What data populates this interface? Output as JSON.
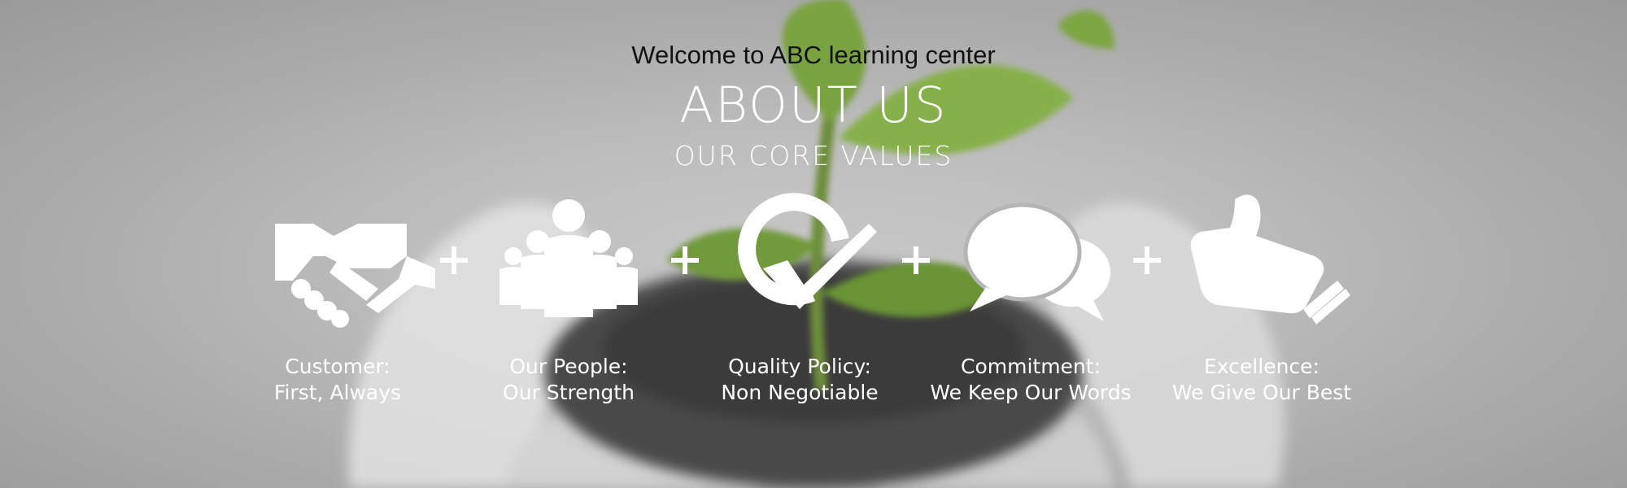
{
  "banner": {
    "welcome": "Welcome to ABC learning center",
    "title": "ABOUT US",
    "subtitle": "OUR CORE VALUES"
  },
  "values": [
    {
      "line1": "Customer:",
      "line2": "First, Always",
      "icon": "handshake-icon"
    },
    {
      "line1": "Our People:",
      "line2": "Our Strength",
      "icon": "people-group-icon"
    },
    {
      "line1": "Quality Policy:",
      "line2": "Non Negotiable",
      "icon": "quality-check-icon"
    },
    {
      "line1": "Commitment:",
      "line2": "We Keep Our Words",
      "icon": "speech-bubbles-icon"
    },
    {
      "line1": "Excellence:",
      "line2": "We Give Our Best",
      "icon": "thumbs-up-icon"
    }
  ],
  "separator": "plus-icon",
  "colors": {
    "text_light": "#ffffff",
    "text_dark": "#111111",
    "leaf_green": "#6f9a3a"
  }
}
